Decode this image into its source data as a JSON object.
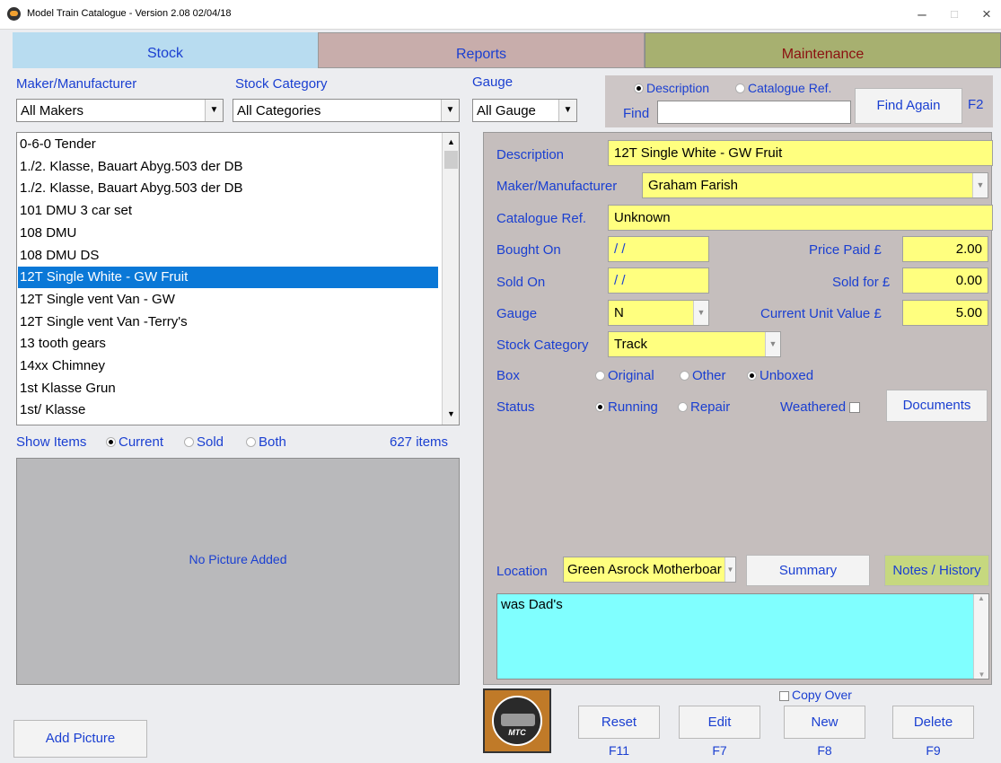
{
  "window": {
    "title": "Model Train Catalogue - Version 2.08 02/04/18",
    "minimize": "–",
    "maximize": "□",
    "close": "×"
  },
  "tabs": [
    "Stock",
    "Reports",
    "Maintenance"
  ],
  "colors": {
    "stock_tab": "#b8dcf0",
    "reports_tab": "#c8adab",
    "maintenance_tab": "#a7b070",
    "panel": "#c5bebd",
    "field_yellow": "#ffff7f",
    "notes_cyan": "#80ffff",
    "selection": "#0a78d7",
    "label_blue": "#1a3fd1"
  },
  "filters": {
    "maker_label": "Maker/Manufacturer",
    "maker_value": "All Makers",
    "category_label": "Stock Category",
    "category_value": "All Categories",
    "gauge_label": "Gauge",
    "gauge_value": "All Gauge"
  },
  "find": {
    "option_description": "Description",
    "option_catalogue": "Catalogue Ref.",
    "label": "Find",
    "value": "",
    "button": "Find Again",
    "shortcut": "F2"
  },
  "list": {
    "items": [
      "0-6-0 Tender",
      "1./2. Klasse, Bauart Abyg.503 der DB",
      "1./2. Klasse, Bauart Abyg.503 der DB",
      "101 DMU 3 car set",
      "108 DMU",
      "108 DMU DS",
      "12T Single White - GW Fruit",
      "12T Single vent Van - GW",
      "12T Single vent Van -Terry's",
      "13 tooth gears",
      "14xx Chimney",
      "1st Klasse Grun",
      "1st/ Klasse"
    ],
    "selected_index": 6
  },
  "show_items": {
    "label": "Show Items",
    "current": "Current",
    "sold": "Sold",
    "both": "Both",
    "count": "627 items"
  },
  "picture": {
    "placeholder": "No Picture Added",
    "add_button": "Add Picture"
  },
  "details": {
    "description_label": "Description",
    "description_value": "12T Single White - GW Fruit",
    "maker_label": "Maker/Manufacturer",
    "maker_value": "Graham Farish",
    "catalogue_label": "Catalogue Ref.",
    "catalogue_value": "Unknown",
    "bought_label": "Bought On",
    "bought_value": "/ /",
    "price_paid_label": "Price Paid £",
    "price_paid_value": "2.00",
    "sold_label": "Sold On",
    "sold_value": "/ /",
    "sold_for_label": "Sold for £",
    "sold_for_value": "0.00",
    "gauge_label": "Gauge",
    "gauge_value": "N",
    "current_value_label": "Current Unit Value £",
    "current_value_value": "5.00",
    "category_label": "Stock Category",
    "category_value": "Track",
    "box_label": "Box",
    "box_original": "Original",
    "box_other": "Other",
    "box_unboxed": "Unboxed",
    "status_label": "Status",
    "status_running": "Running",
    "status_repair": "Repair",
    "weathered_label": "Weathered",
    "documents_button": "Documents",
    "location_label": "Location",
    "location_value": "Green Asrock Motherboar",
    "summary_button": "Summary",
    "notes_button": "Notes / History",
    "notes_text": "was Dad's"
  },
  "bottom": {
    "logo_text": "MTC",
    "copy_over": "Copy Over",
    "reset": "Reset",
    "reset_key": "F11",
    "edit": "Edit",
    "edit_key": "F7",
    "new": "New",
    "new_key": "F8",
    "delete": "Delete",
    "delete_key": "F9"
  }
}
